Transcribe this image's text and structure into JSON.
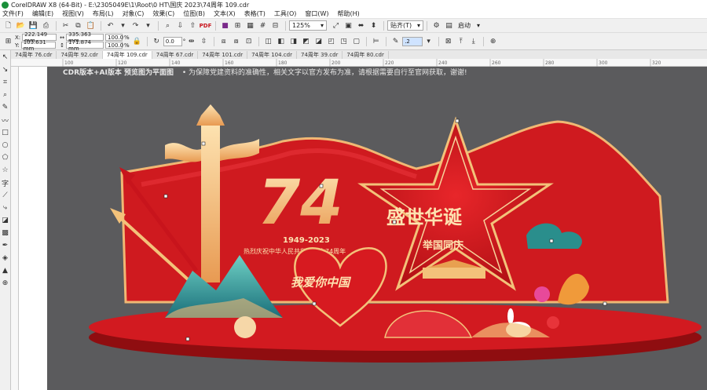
{
  "window": {
    "title": "CorelDRAW X8 (64-Bit) - E:\\2305049E\\1\\Root\\0 HT\\国庆 2023\\74周年 109.cdr"
  },
  "menu": [
    "文件(F)",
    "编辑(E)",
    "视图(V)",
    "布局(L)",
    "对象(C)",
    "效果(C)",
    "位图(B)",
    "文本(X)",
    "表格(T)",
    "工具(O)",
    "窗口(W)",
    "帮助(H)"
  ],
  "toolbar": {
    "zoom": "125%",
    "snap_label": "贴齐(T)",
    "launch_label": "启动"
  },
  "props": {
    "x": "222.149 mm",
    "y": "103.631 mm",
    "w": "335.363 mm",
    "h": "171.874 mm",
    "sx": "100.0",
    "sy": "100.0",
    "pct": "%",
    "angle": "0.0",
    "deg": "°",
    "outline": ".2"
  },
  "tabs": [
    "74周年 76.cdr",
    "74周年 92.cdr",
    "74周年 109.cdr",
    "74周年 67.cdr",
    "74周年 101.cdr",
    "74周年 104.cdr",
    "74周年 39.cdr",
    "74周年 80.cdr"
  ],
  "active_tab": 2,
  "ruler_numbers": [
    "100",
    "120",
    "140",
    "160",
    "180",
    "200",
    "220",
    "240",
    "260",
    "280",
    "300",
    "320"
  ],
  "canvas": {
    "notice_bold": "CDR版本+AI版本   预览图为平面图",
    "notice_text": "• 为保障党建资料的准确性，相关文字以官方发布为准，请根据需要自行至官网获取，谢谢!",
    "design": {
      "number": "74",
      "years": "1949-2023",
      "slogan": "热烈庆祝中华人民共和国成立74周年",
      "star_title": "盛世华诞",
      "star_sub": "举国同庆",
      "heart_text": "我爱你中国"
    }
  },
  "colors": {
    "red": "#c8141c",
    "dark_red": "#9e0d12",
    "gold": "#f3c27a",
    "teal": "#2a9d9a",
    "canvas": "#5b5b5d"
  }
}
